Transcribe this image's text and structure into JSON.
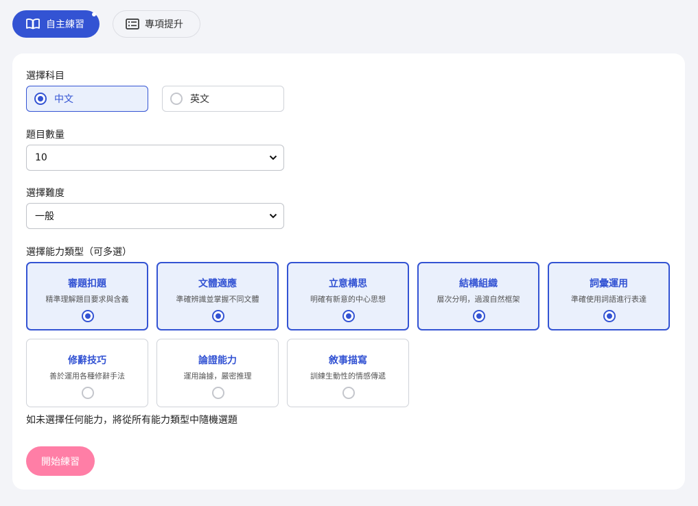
{
  "tabs": [
    {
      "label": "自主練習",
      "icon": "book-icon",
      "active": true
    },
    {
      "label": "專項提升",
      "icon": "list-icon",
      "active": false
    }
  ],
  "form": {
    "subject_label": "選擇科目",
    "subjects": [
      {
        "label": "中文",
        "selected": true
      },
      {
        "label": "英文",
        "selected": false
      }
    ],
    "count_label": "題目數量",
    "count_value": "10",
    "difficulty_label": "選擇難度",
    "difficulty_value": "一般",
    "ability_label": "選擇能力類型（可多選）",
    "abilities": [
      {
        "title": "審題扣題",
        "desc": "精準理解題目要求與含義",
        "selected": true
      },
      {
        "title": "文體適應",
        "desc": "準確辨識並掌握不同文體",
        "selected": true
      },
      {
        "title": "立意構思",
        "desc": "明確有新意的中心思想",
        "selected": true
      },
      {
        "title": "結構組織",
        "desc": "層次分明，過渡自然框架",
        "selected": true
      },
      {
        "title": "詞彙運用",
        "desc": "準確使用詞語進行表達",
        "selected": true
      },
      {
        "title": "修辭技巧",
        "desc": "善於運用各種修辭手法",
        "selected": false
      },
      {
        "title": "論證能力",
        "desc": "運用論據，嚴密推理",
        "selected": false
      },
      {
        "title": "敘事描寫",
        "desc": "訓練生動性的情感傳遞",
        "selected": false
      }
    ],
    "note": "如未選擇任何能力，將從所有能力類型中隨機選題",
    "start_button": "開始練習"
  },
  "colors": {
    "accent": "#3353d3",
    "start_button": "#ff7ea6",
    "selected_bg": "#eaf0fc"
  }
}
